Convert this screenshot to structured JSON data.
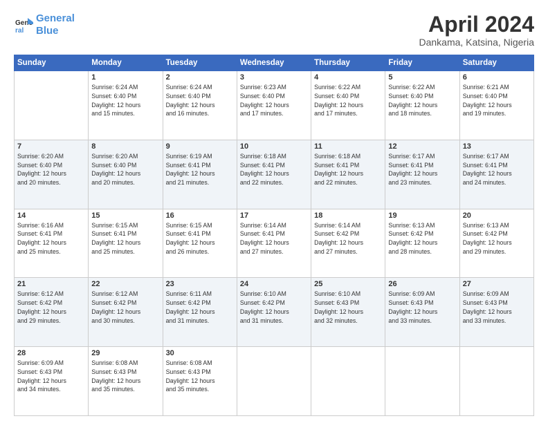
{
  "header": {
    "logo_line1": "General",
    "logo_line2": "Blue",
    "title": "April 2024",
    "subtitle": "Dankama, Katsina, Nigeria"
  },
  "columns": [
    "Sunday",
    "Monday",
    "Tuesday",
    "Wednesday",
    "Thursday",
    "Friday",
    "Saturday"
  ],
  "weeks": [
    [
      {
        "day": "",
        "info": ""
      },
      {
        "day": "1",
        "info": "Sunrise: 6:24 AM\nSunset: 6:40 PM\nDaylight: 12 hours\nand 15 minutes."
      },
      {
        "day": "2",
        "info": "Sunrise: 6:24 AM\nSunset: 6:40 PM\nDaylight: 12 hours\nand 16 minutes."
      },
      {
        "day": "3",
        "info": "Sunrise: 6:23 AM\nSunset: 6:40 PM\nDaylight: 12 hours\nand 17 minutes."
      },
      {
        "day": "4",
        "info": "Sunrise: 6:22 AM\nSunset: 6:40 PM\nDaylight: 12 hours\nand 17 minutes."
      },
      {
        "day": "5",
        "info": "Sunrise: 6:22 AM\nSunset: 6:40 PM\nDaylight: 12 hours\nand 18 minutes."
      },
      {
        "day": "6",
        "info": "Sunrise: 6:21 AM\nSunset: 6:40 PM\nDaylight: 12 hours\nand 19 minutes."
      }
    ],
    [
      {
        "day": "7",
        "info": "Sunrise: 6:20 AM\nSunset: 6:40 PM\nDaylight: 12 hours\nand 20 minutes."
      },
      {
        "day": "8",
        "info": "Sunrise: 6:20 AM\nSunset: 6:40 PM\nDaylight: 12 hours\nand 20 minutes."
      },
      {
        "day": "9",
        "info": "Sunrise: 6:19 AM\nSunset: 6:41 PM\nDaylight: 12 hours\nand 21 minutes."
      },
      {
        "day": "10",
        "info": "Sunrise: 6:18 AM\nSunset: 6:41 PM\nDaylight: 12 hours\nand 22 minutes."
      },
      {
        "day": "11",
        "info": "Sunrise: 6:18 AM\nSunset: 6:41 PM\nDaylight: 12 hours\nand 22 minutes."
      },
      {
        "day": "12",
        "info": "Sunrise: 6:17 AM\nSunset: 6:41 PM\nDaylight: 12 hours\nand 23 minutes."
      },
      {
        "day": "13",
        "info": "Sunrise: 6:17 AM\nSunset: 6:41 PM\nDaylight: 12 hours\nand 24 minutes."
      }
    ],
    [
      {
        "day": "14",
        "info": "Sunrise: 6:16 AM\nSunset: 6:41 PM\nDaylight: 12 hours\nand 25 minutes."
      },
      {
        "day": "15",
        "info": "Sunrise: 6:15 AM\nSunset: 6:41 PM\nDaylight: 12 hours\nand 25 minutes."
      },
      {
        "day": "16",
        "info": "Sunrise: 6:15 AM\nSunset: 6:41 PM\nDaylight: 12 hours\nand 26 minutes."
      },
      {
        "day": "17",
        "info": "Sunrise: 6:14 AM\nSunset: 6:41 PM\nDaylight: 12 hours\nand 27 minutes."
      },
      {
        "day": "18",
        "info": "Sunrise: 6:14 AM\nSunset: 6:42 PM\nDaylight: 12 hours\nand 27 minutes."
      },
      {
        "day": "19",
        "info": "Sunrise: 6:13 AM\nSunset: 6:42 PM\nDaylight: 12 hours\nand 28 minutes."
      },
      {
        "day": "20",
        "info": "Sunrise: 6:13 AM\nSunset: 6:42 PM\nDaylight: 12 hours\nand 29 minutes."
      }
    ],
    [
      {
        "day": "21",
        "info": "Sunrise: 6:12 AM\nSunset: 6:42 PM\nDaylight: 12 hours\nand 29 minutes."
      },
      {
        "day": "22",
        "info": "Sunrise: 6:12 AM\nSunset: 6:42 PM\nDaylight: 12 hours\nand 30 minutes."
      },
      {
        "day": "23",
        "info": "Sunrise: 6:11 AM\nSunset: 6:42 PM\nDaylight: 12 hours\nand 31 minutes."
      },
      {
        "day": "24",
        "info": "Sunrise: 6:10 AM\nSunset: 6:42 PM\nDaylight: 12 hours\nand 31 minutes."
      },
      {
        "day": "25",
        "info": "Sunrise: 6:10 AM\nSunset: 6:43 PM\nDaylight: 12 hours\nand 32 minutes."
      },
      {
        "day": "26",
        "info": "Sunrise: 6:09 AM\nSunset: 6:43 PM\nDaylight: 12 hours\nand 33 minutes."
      },
      {
        "day": "27",
        "info": "Sunrise: 6:09 AM\nSunset: 6:43 PM\nDaylight: 12 hours\nand 33 minutes."
      }
    ],
    [
      {
        "day": "28",
        "info": "Sunrise: 6:09 AM\nSunset: 6:43 PM\nDaylight: 12 hours\nand 34 minutes."
      },
      {
        "day": "29",
        "info": "Sunrise: 6:08 AM\nSunset: 6:43 PM\nDaylight: 12 hours\nand 35 minutes."
      },
      {
        "day": "30",
        "info": "Sunrise: 6:08 AM\nSunset: 6:43 PM\nDaylight: 12 hours\nand 35 minutes."
      },
      {
        "day": "",
        "info": ""
      },
      {
        "day": "",
        "info": ""
      },
      {
        "day": "",
        "info": ""
      },
      {
        "day": "",
        "info": ""
      }
    ]
  ]
}
